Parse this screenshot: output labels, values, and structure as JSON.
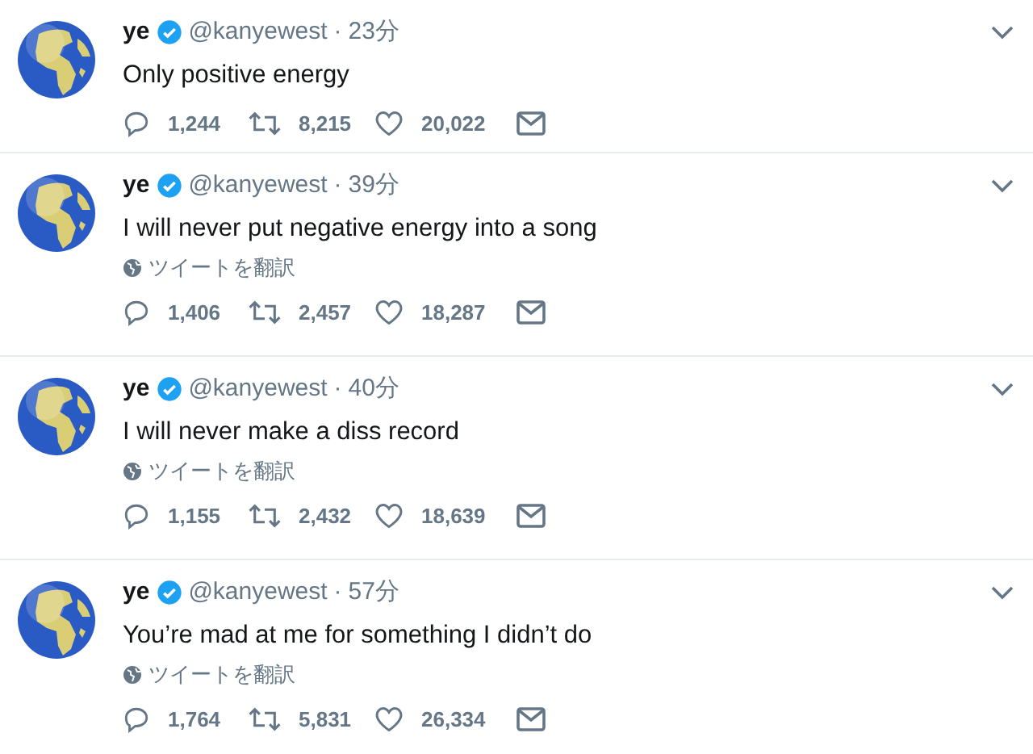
{
  "tweets": [
    {
      "name": "ye",
      "verified": true,
      "handle": "@kanyewest",
      "separator": "·",
      "time": "23分",
      "text": "Only positive energy",
      "replies": "1,244",
      "retweets": "8,215",
      "likes": "20,022"
    },
    {
      "name": "ye",
      "verified": true,
      "handle": "@kanyewest",
      "separator": "·",
      "time": "39分",
      "text": "I will never put negative energy into a song",
      "translate": "ツイートを翻訳",
      "replies": "1,406",
      "retweets": "2,457",
      "likes": "18,287"
    },
    {
      "name": "ye",
      "verified": true,
      "handle": "@kanyewest",
      "separator": "·",
      "time": "40分",
      "text": "I will never make a diss record",
      "translate": "ツイートを翻訳",
      "replies": "1,155",
      "retweets": "2,432",
      "likes": "18,639"
    },
    {
      "name": "ye",
      "verified": true,
      "handle": "@kanyewest",
      "separator": "·",
      "time": "57分",
      "text": "You’re mad at me for something I didn’t do",
      "translate": "ツイートを翻訳",
      "replies": "1,764",
      "retweets": "5,831",
      "likes": "26,334"
    }
  ]
}
